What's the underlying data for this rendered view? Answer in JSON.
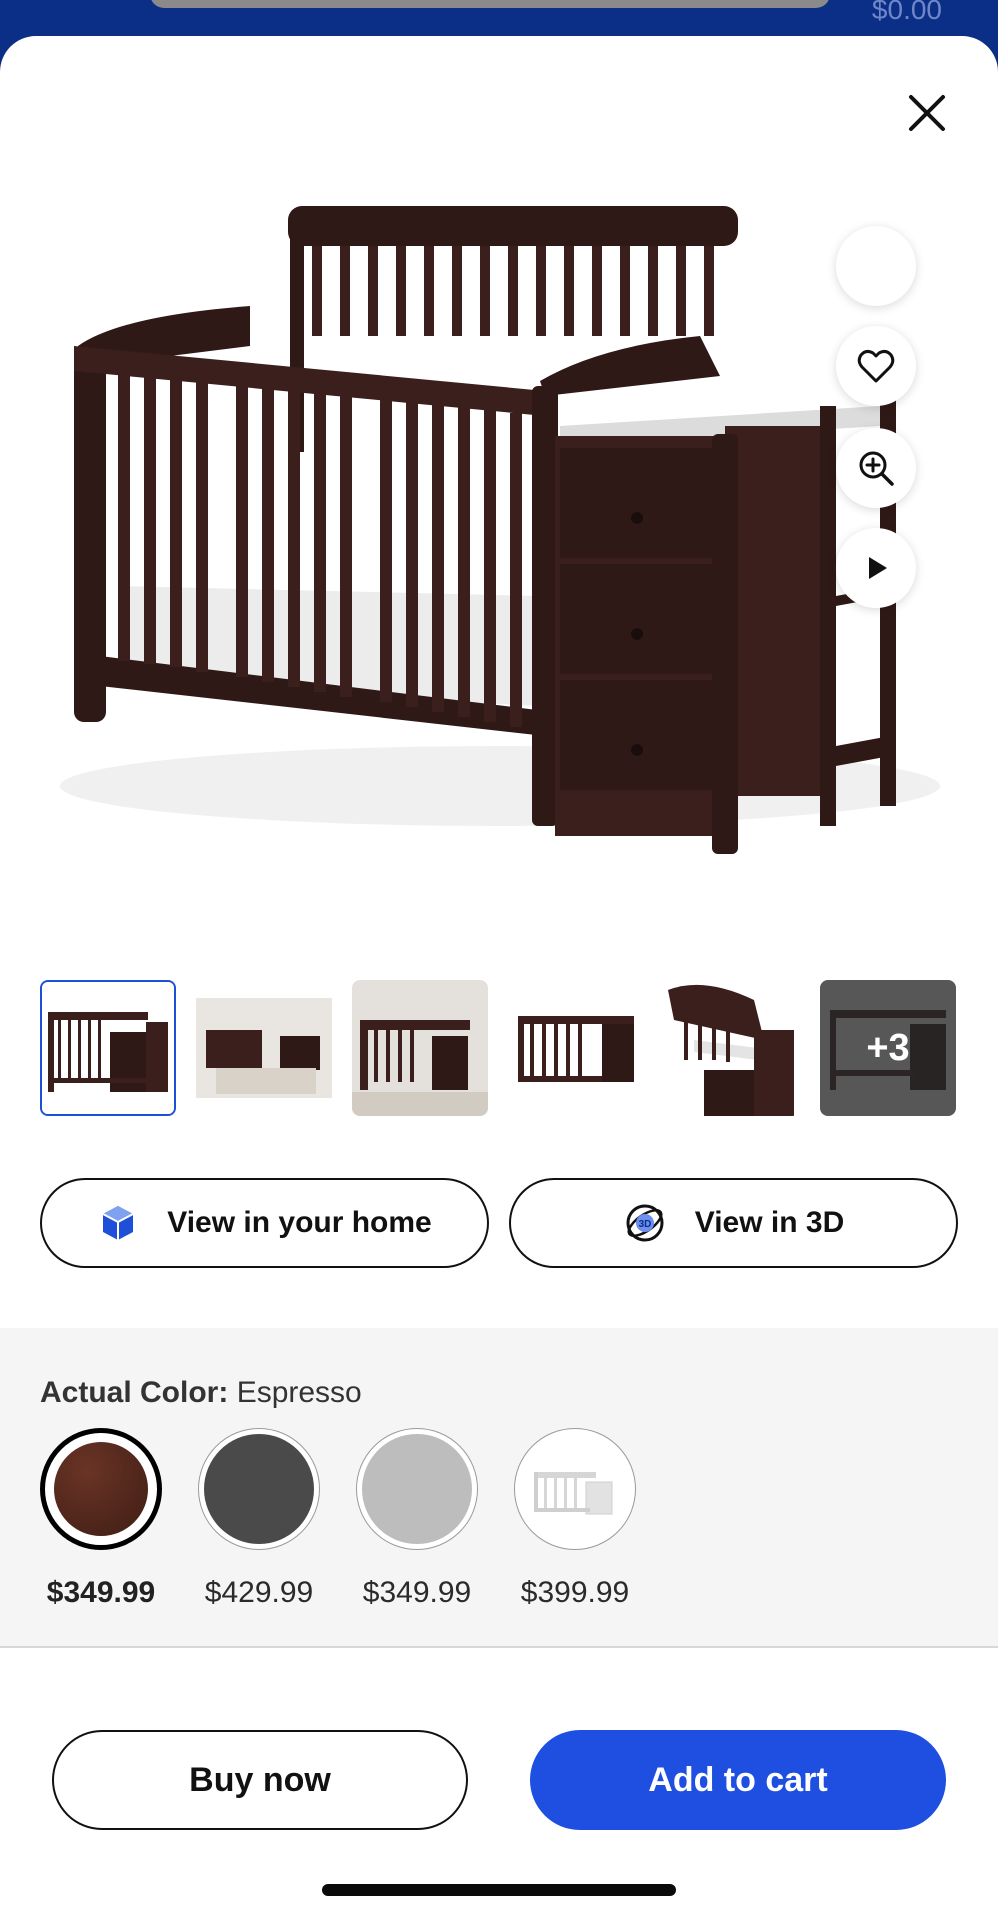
{
  "topbar": {
    "cart_total": "$0.00"
  },
  "gallery": {
    "more_count": "+3",
    "thumbnail_count": 6,
    "active_index": 0
  },
  "view_buttons": {
    "home_label": "View in your home",
    "three_d_label": "View in 3D"
  },
  "color": {
    "label_prefix": "Actual Color:",
    "selected_name": "Espresso",
    "options": [
      {
        "price": "$349.99",
        "swatch_color": "#4a2418",
        "selected": true
      },
      {
        "price": "$429.99",
        "swatch_color": "#4a4a4a",
        "selected": false
      },
      {
        "price": "$349.99",
        "swatch_color": "#bdbdbd",
        "selected": false
      },
      {
        "price": "$399.99",
        "swatch_color": "#ffffff",
        "selected": false,
        "image": "white-crib-thumbnail"
      }
    ]
  },
  "actions": {
    "buy_now_label": "Buy now",
    "add_to_cart_label": "Add to cart"
  },
  "colors": {
    "accent": "#1f4fe0",
    "header": "#0b2f86",
    "crib_wood": "#3a1f1d"
  }
}
